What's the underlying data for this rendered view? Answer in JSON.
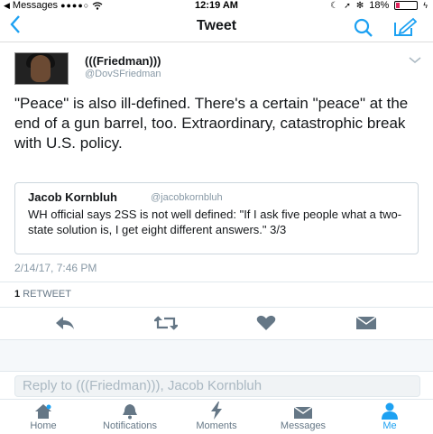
{
  "status_bar": {
    "back_app": "Messages",
    "signal": "●●●●○",
    "time": "12:19 AM",
    "battery": "18%",
    "battery_level": 0.18
  },
  "nav": {
    "title": "Tweet",
    "back_icon": "chevron-left-icon",
    "search_icon": "search-icon",
    "compose_icon": "compose-icon"
  },
  "tweet": {
    "author_name": "(((Friedman)))",
    "author_handle": "@DovSFriedman",
    "text": "\"Peace\" is also ill-defined. There's a certain \"peace\" at the end of a gun barrel, too. Extraordinary, catastrophic break with U.S. policy.",
    "quoted": {
      "name": "Jacob Kornbluh",
      "handle": "@jacobkornbluh",
      "text": "WH official says 2SS is not well defined: \"If I ask five people what a two-state solution is, I get eight different answers.\" 3/3"
    },
    "timestamp": "2/14/17, 7:46 PM",
    "retweet_count": "1",
    "retweet_label": "RETWEET"
  },
  "reply": {
    "placeholder": "Reply to (((Friedman))), Jacob Kornbluh"
  },
  "tabbar": {
    "items": [
      {
        "label": "Home",
        "icon": "home-icon"
      },
      {
        "label": "Notifications",
        "icon": "bell-icon"
      },
      {
        "label": "Moments",
        "icon": "lightning-icon"
      },
      {
        "label": "Messages",
        "icon": "envelope-icon"
      },
      {
        "label": "Me",
        "icon": "person-icon"
      }
    ],
    "active": "Me"
  },
  "colors": {
    "accent": "#1da1f2",
    "text": "#14171a",
    "muted": "#8899a6",
    "like": "#657786"
  }
}
